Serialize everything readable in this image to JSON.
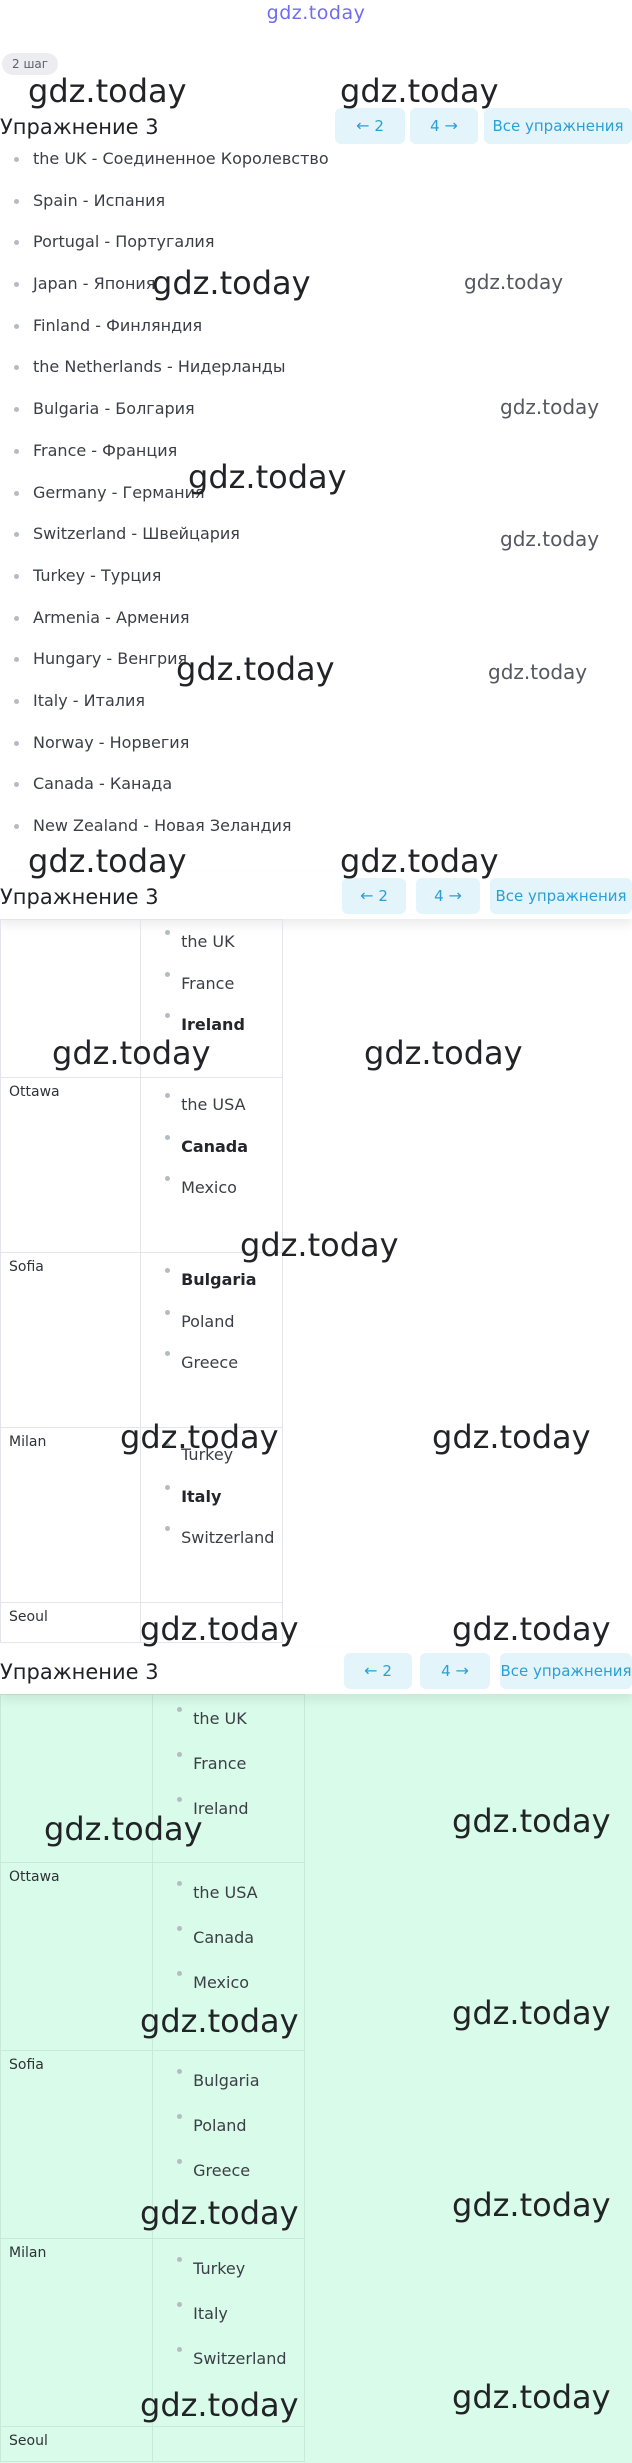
{
  "site": {
    "logo": "gdz.today"
  },
  "step_badge": "2 шаг",
  "section_title": "Упражнение 3",
  "nav": {
    "prev": "2",
    "next": "4",
    "all": "Все упражнения"
  },
  "watermark": "gdz.today",
  "countries": [
    "the UK - Соединенное Королевство",
    "Spain - Испания",
    "Portugal - Португалия",
    "Japan - Япония",
    "Finland - Финляндия",
    "the Netherlands - Нидерланды",
    "Bulgaria - Болгария",
    "France - Франция",
    "Germany - Германия",
    "Switzerland - Швейцария",
    "Turkey - Турция",
    "Armenia - Армения",
    "Hungary - Венгрия",
    "Italy - Италия",
    "Norway - Норвегия",
    "Canada - Канада",
    "New Zealand - Новая Зеландия"
  ],
  "table": {
    "top_options": [
      "the UK",
      "France",
      "Ireland"
    ],
    "rows": [
      {
        "city": "Ottawa",
        "options": [
          "the USA",
          "Canada",
          "Mexico"
        ]
      },
      {
        "city": "Sofia",
        "options": [
          "Bulgaria",
          "Poland",
          "Greece"
        ]
      },
      {
        "city": "Milan",
        "options": [
          "Turkey",
          "Italy",
          "Switzerland"
        ]
      },
      {
        "city": "Seoul",
        "options": []
      }
    ]
  },
  "colors": {
    "accent": "#2aa0d6",
    "nav_bg": "#e3f4fb",
    "answer_bg": "#d9fbe9",
    "logo": "#6f6cf0"
  }
}
